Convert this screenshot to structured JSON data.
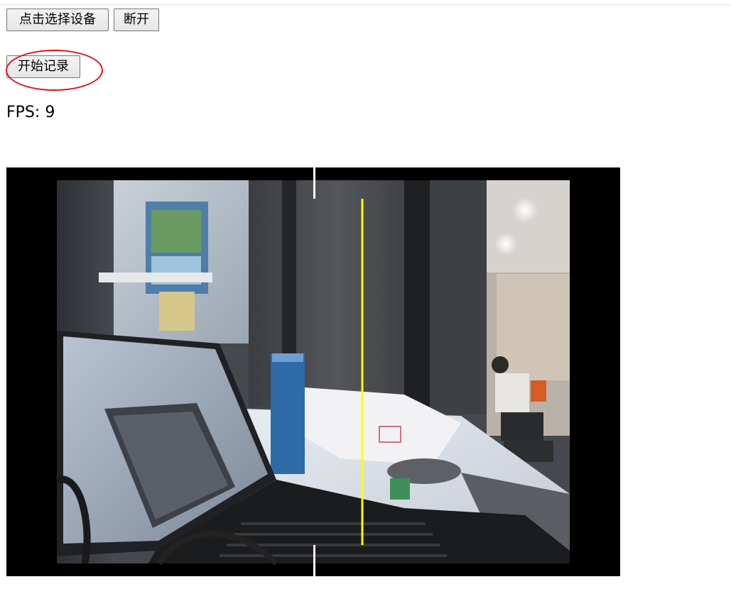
{
  "controls": {
    "select_device_label": "点击选择设备",
    "disconnect_label": "断开",
    "start_record_label": "开始记录"
  },
  "status": {
    "fps_label": "FPS:",
    "fps_value": "9"
  },
  "colors": {
    "annotation": "#e0141c",
    "guide_center": "#ffffff",
    "guide_marker": "#ffff00"
  }
}
